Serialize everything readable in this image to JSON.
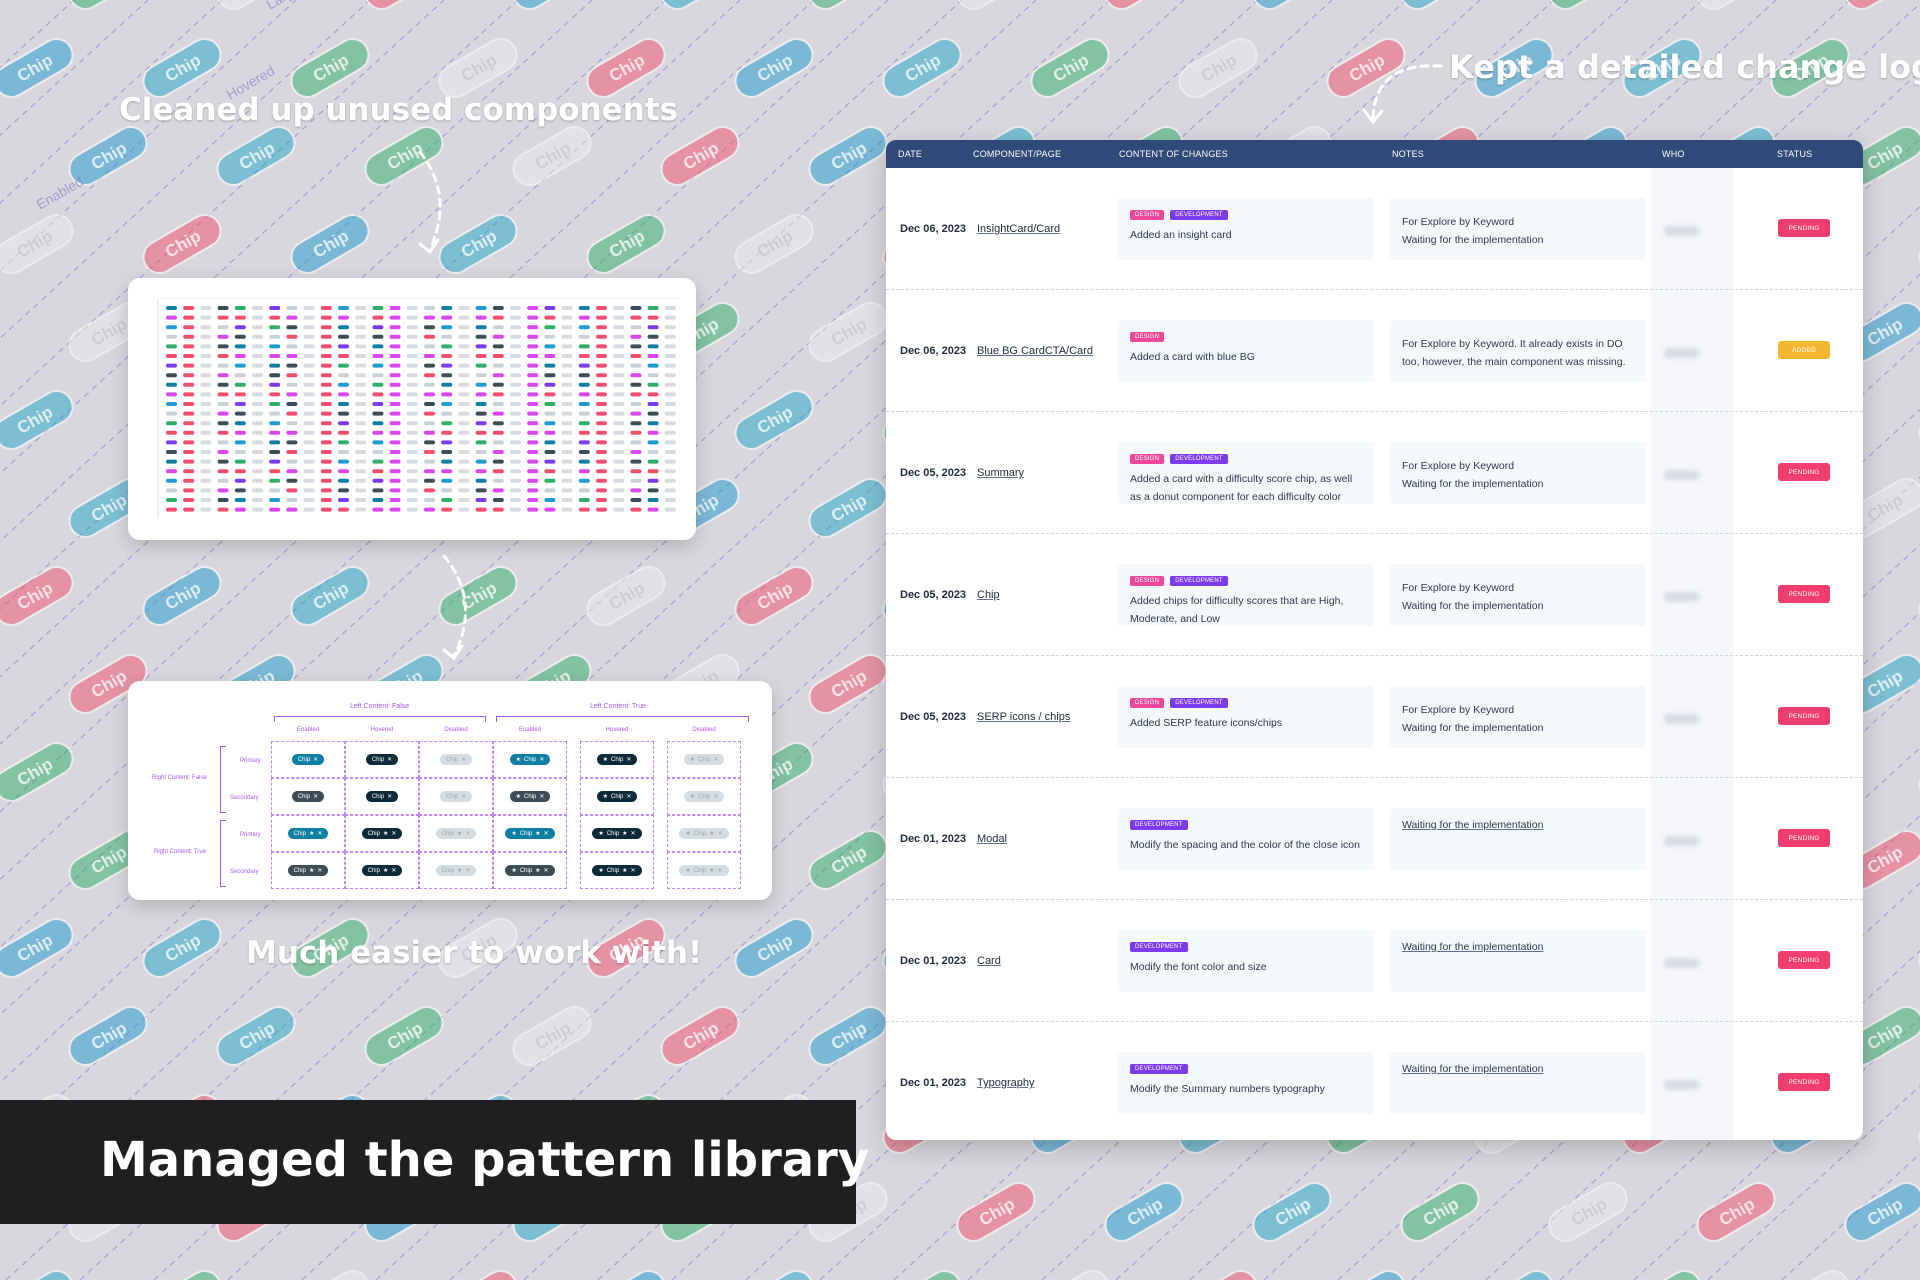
{
  "headings": {
    "cleaned": "Cleaned up unused components",
    "easier": "Much easier to work with!",
    "changelog": "Kept a detailed change log"
  },
  "banner": {
    "title": "Managed the pattern library"
  },
  "background": {
    "chip_label": "Chip",
    "faint_labels": [
      "Large",
      "Hovered",
      "Enabled"
    ],
    "chip_colors": [
      "#22a6c9",
      "#ef4f6d",
      "#2fae6a",
      "#1f9bd1",
      "#e9e9ee"
    ]
  },
  "after_thumbnail": {
    "group_labels": [
      "Left Content: False",
      "Left Content: True"
    ],
    "column_labels": [
      "Enabled",
      "Hovered",
      "Disabled",
      "Enabled",
      "Hovered",
      "Disabled"
    ],
    "row_group_labels": [
      "Right Content: False",
      "Right Content: True"
    ],
    "row_labels": [
      "Primary",
      "Secondary",
      "Primary",
      "Secondary"
    ],
    "chip_label": "Chip",
    "colors": {
      "primary": "#0f7ea3",
      "secondary": "#3d4d57",
      "hover": "#0d2a3a",
      "disabled": "#d5dde2"
    }
  },
  "log": {
    "columns": [
      "DATE",
      "COMPONENT/PAGE",
      "CONTENT OF CHANGES",
      "NOTES",
      "WHO",
      "STATUS"
    ],
    "tag_labels": {
      "design": "DESIGN",
      "development": "DEVELOPMENT"
    },
    "status_colors": {
      "PENDING": "#ef3e6e",
      "ADDED": "#f5b731"
    },
    "rows": [
      {
        "date": "Dec 06, 2023",
        "component": "InsightCard/Card",
        "tags": [
          "design",
          "development"
        ],
        "content": "Added an insight card",
        "notes": [
          "For Explore by Keyword",
          "Waiting for the implementation"
        ],
        "notes_link": false,
        "status": "PENDING"
      },
      {
        "date": "Dec 06, 2023",
        "component": "Blue BG CardCTA/Card",
        "tags": [
          "design"
        ],
        "content": "Added a card with blue BG",
        "notes": [
          "For Explore by Keyword. It already exists in DO",
          "too, however, the main component was missing."
        ],
        "notes_link": false,
        "status": "ADDED"
      },
      {
        "date": "Dec 05, 2023",
        "component": "Summary",
        "tags": [
          "design",
          "development"
        ],
        "content": "Added a card with a difficulty score chip, as well as a donut component for each difficulty color",
        "notes": [
          "For Explore by Keyword",
          "Waiting for the implementation"
        ],
        "notes_link": false,
        "status": "PENDING"
      },
      {
        "date": "Dec 05, 2023",
        "component": "Chip",
        "tags": [
          "design",
          "development"
        ],
        "content": "Added chips for difficulty scores that are High, Moderate, and Low",
        "notes": [
          "For Explore by Keyword",
          "Waiting for the implementation"
        ],
        "notes_link": false,
        "status": "PENDING"
      },
      {
        "date": "Dec 05, 2023",
        "component": "SERP icons / chips",
        "tags": [
          "design",
          "development"
        ],
        "content": "Added SERP feature icons/chips",
        "notes": [
          "For Explore by Keyword",
          "Waiting for the implementation"
        ],
        "notes_link": false,
        "status": "PENDING"
      },
      {
        "date": "Dec 01, 2023",
        "component": "Modal",
        "tags": [
          "development"
        ],
        "content": "Modify the spacing and the color of the close icon",
        "notes": [
          "Waiting for the implementation"
        ],
        "notes_link": true,
        "status": "PENDING"
      },
      {
        "date": "Dec 01, 2023",
        "component": "Card",
        "tags": [
          "development"
        ],
        "content": "Modify the font color and size",
        "notes": [
          "Waiting for the implementation"
        ],
        "notes_link": true,
        "status": "PENDING"
      },
      {
        "date": "Dec 01, 2023",
        "component": "Typography",
        "tags": [
          "development"
        ],
        "content": "Modify the Summary numbers typography",
        "notes": [
          "Waiting for the implementation"
        ],
        "notes_link": true,
        "status": "PENDING"
      }
    ]
  }
}
